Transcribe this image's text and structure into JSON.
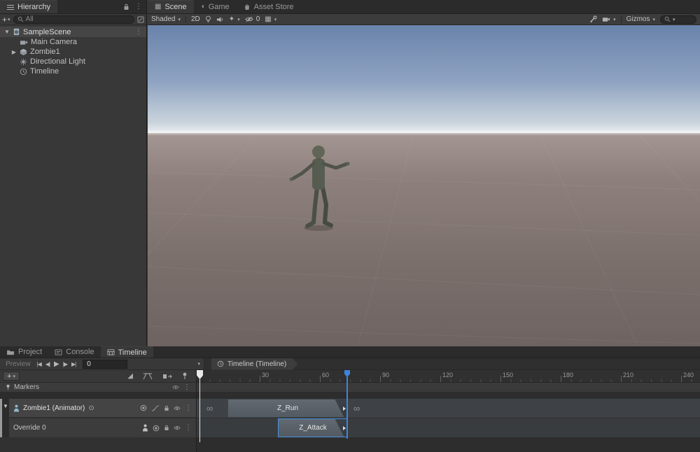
{
  "colors": {
    "accent_blue": "#4a90e2",
    "duration_marker_blue": "#3d84dd",
    "panel_bg": "#383838",
    "clip_gray": "#596067",
    "sky_top": "#6a83ab",
    "ground_brown": "#8d807c"
  },
  "icons": {
    "plus": "+",
    "dropdown": "▾",
    "foldout_open": "▼",
    "foldout_closed": "▶",
    "menu": "⋮",
    "infinity": "∞",
    "object_picker": "⊙",
    "sparkle": "✦",
    "grid": "▦",
    "game": "◖",
    "curves": "◢"
  },
  "hierarchy": {
    "tab_label": "Hierarchy",
    "search_placeholder": "All",
    "scene_row": {
      "label": "SampleScene"
    },
    "items": [
      {
        "label": "Main Camera"
      },
      {
        "label": "Zombie1"
      },
      {
        "label": "Directional Light"
      },
      {
        "label": "Timeline"
      }
    ]
  },
  "scene": {
    "tabs": [
      {
        "label": "Scene"
      },
      {
        "label": "Game"
      },
      {
        "label": "Asset Store"
      }
    ],
    "toolbar": {
      "shading_mode": "Shaded",
      "mode_2d": "2D",
      "hidden_count": "0",
      "gizmos_label": "Gizmos"
    }
  },
  "bottom_tabs": [
    {
      "label": "Project"
    },
    {
      "label": "Console"
    },
    {
      "label": "Timeline"
    }
  ],
  "timeline": {
    "preview_label": "Preview",
    "frame_value": "0",
    "breadcrumb": "Timeline (Timeline)",
    "markers_label": "Markers",
    "transport": {
      "goto_start": "|◀",
      "prev_frame": "◀|",
      "play": "▶",
      "next_frame": "|▶",
      "goto_end": "▶|"
    },
    "ruler_labels": [
      "30",
      "60",
      "90",
      "120",
      "150",
      "180",
      "210",
      "240"
    ],
    "tracks": [
      {
        "label": "Zombie1 (Animator)",
        "clip_label": "Z_Run"
      },
      {
        "label": "Override 0",
        "clip_label": "Z_Attack"
      }
    ]
  }
}
